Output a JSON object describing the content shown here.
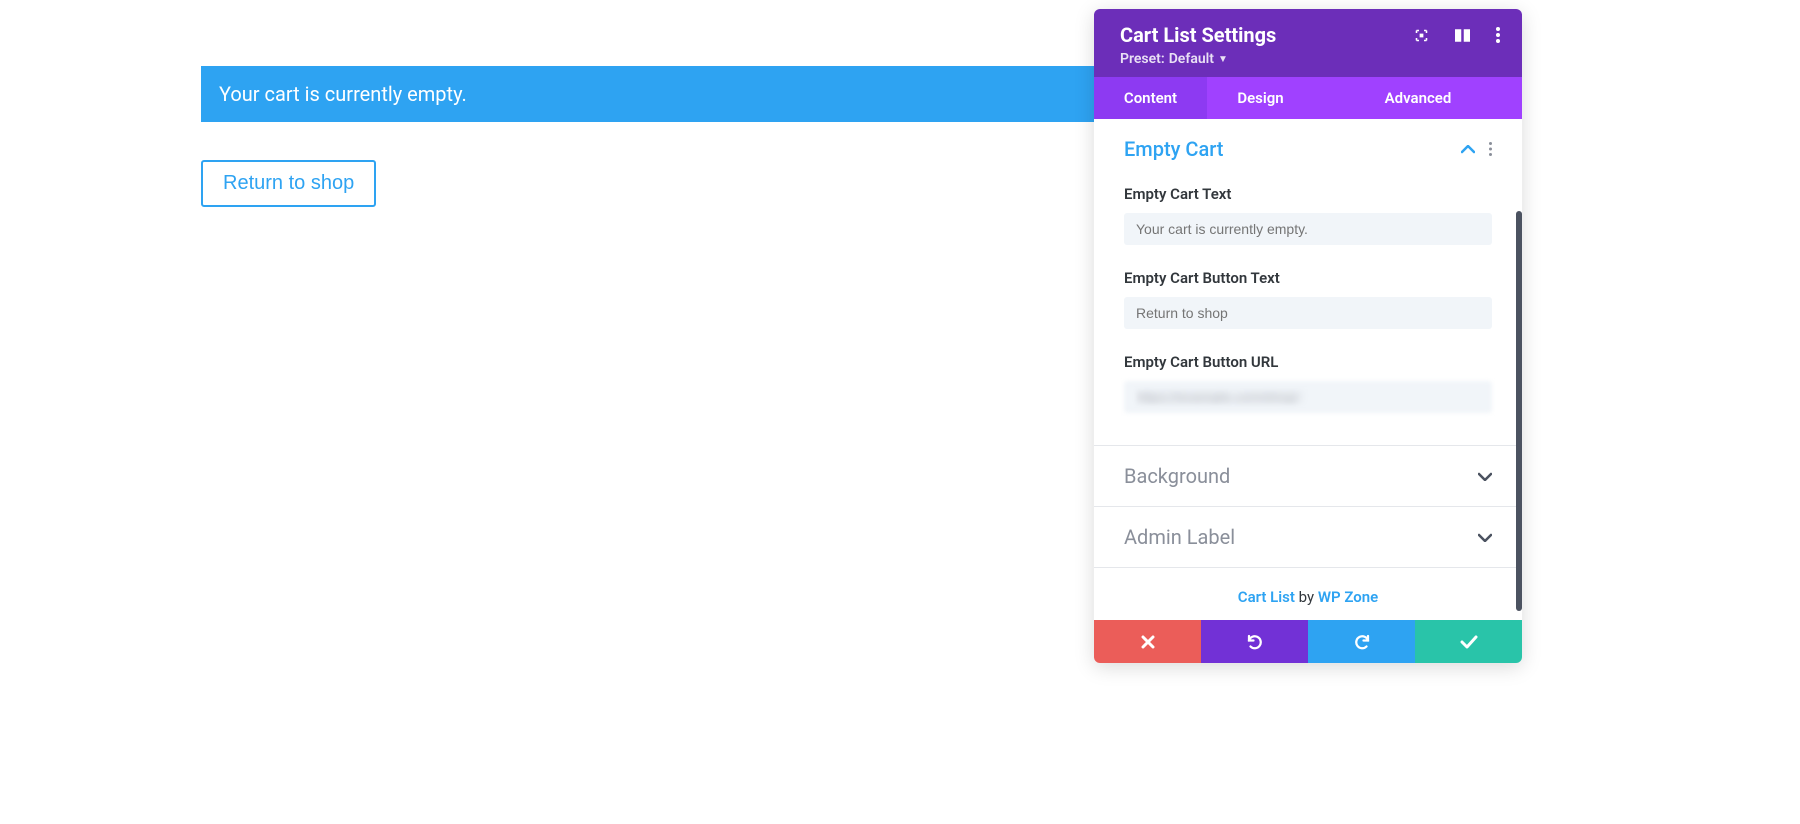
{
  "main": {
    "empty_cart_notice": "Your cart is currently empty.",
    "return_button": "Return to shop"
  },
  "panel": {
    "title": "Cart List Settings",
    "preset_prefix": "Preset:",
    "preset_value": "Default",
    "tabs": {
      "content": "Content",
      "design": "Design",
      "advanced": "Advanced"
    },
    "sections": {
      "empty_cart_title": "Empty Cart",
      "background_title": "Background",
      "admin_label_title": "Admin Label"
    },
    "fields": {
      "empty_cart_text": {
        "label": "Empty Cart Text",
        "placeholder": "Your cart is currently empty."
      },
      "empty_cart_button_text": {
        "label": "Empty Cart Button Text",
        "placeholder": "Return to shop"
      },
      "empty_cart_button_url": {
        "label": "Empty Cart Button URL",
        "value": "https://example.com/shop/"
      }
    },
    "footer_note": {
      "link1": "Cart List",
      "by": " by ",
      "link2": "WP Zone"
    }
  }
}
